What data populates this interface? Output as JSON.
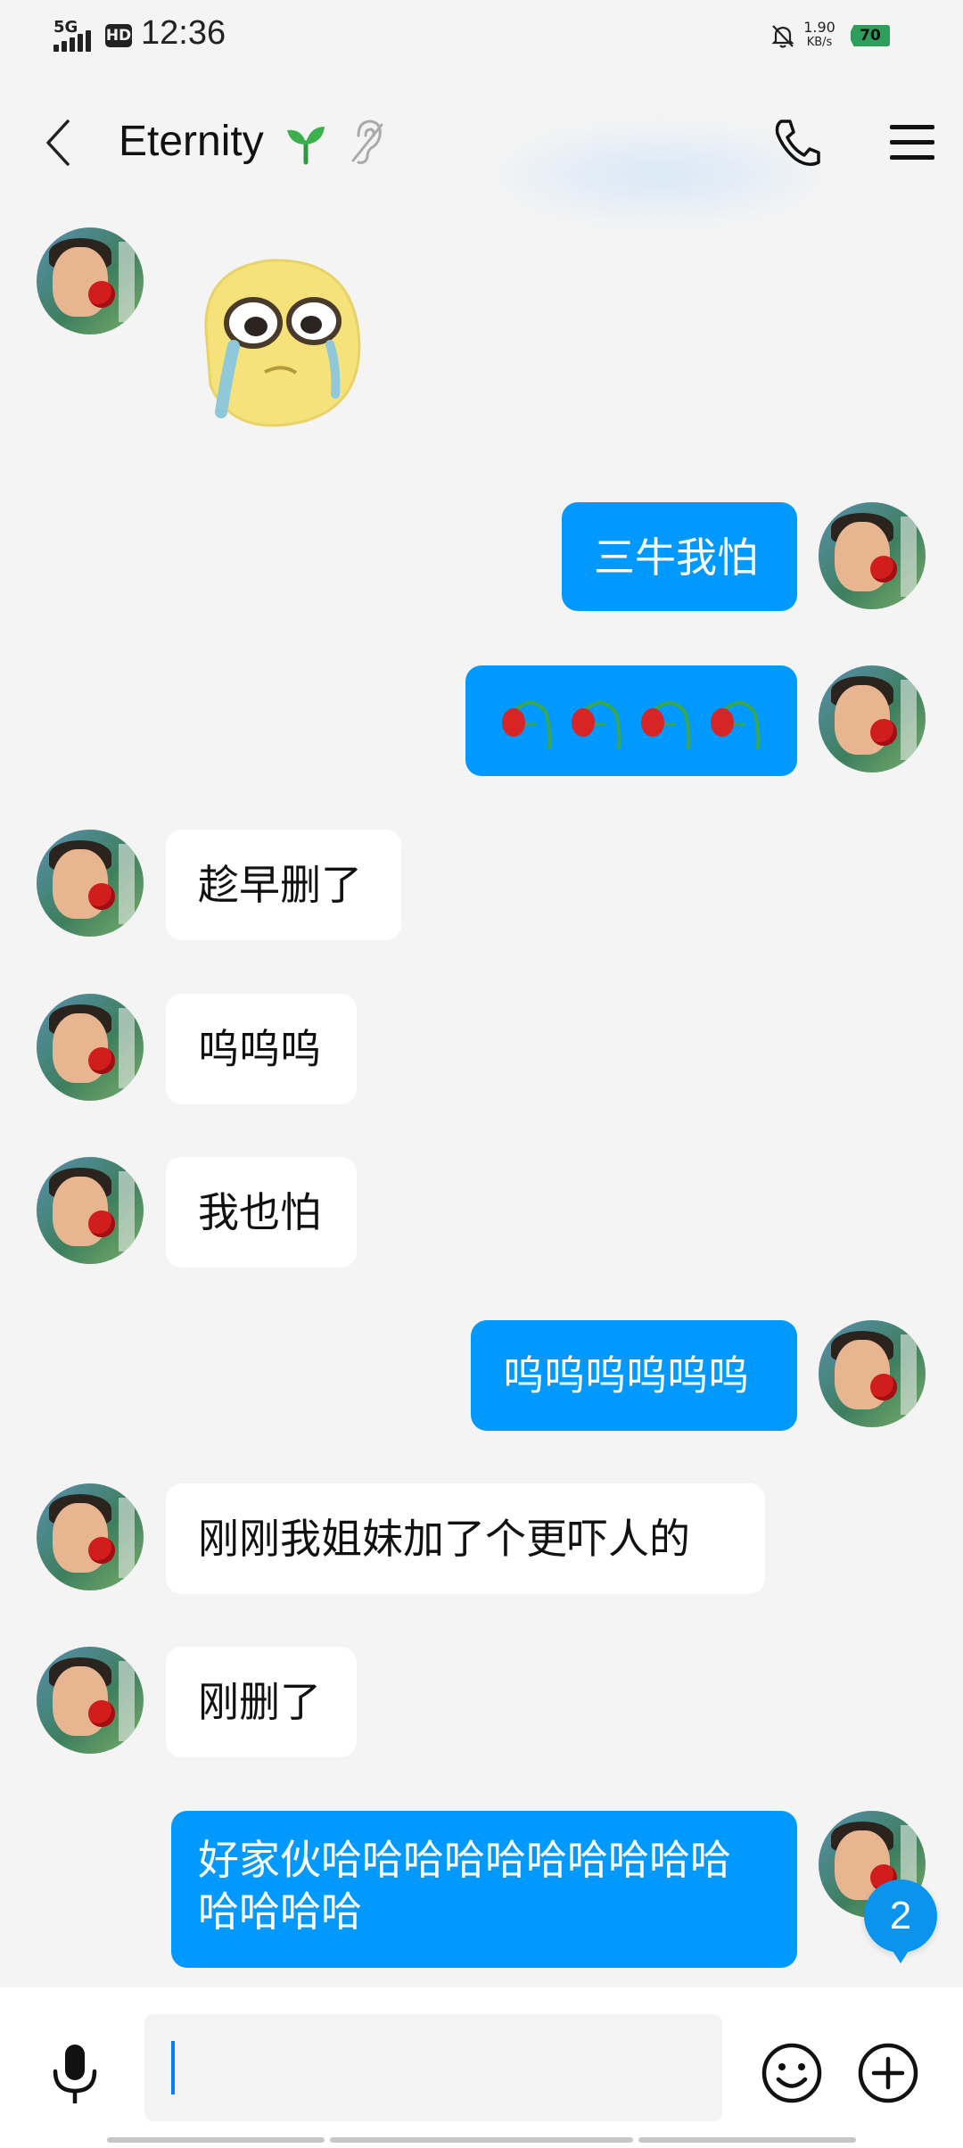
{
  "status_bar": {
    "network": "5G",
    "hd_label": "HD",
    "time": "12:36",
    "speed_value": "1.90",
    "speed_unit": "KB/s",
    "battery": "70"
  },
  "header": {
    "contact_name": "Eternity",
    "icons": [
      "back-icon",
      "sprout-icon",
      "ear-icon",
      "phone-icon",
      "menu-icon"
    ]
  },
  "messages": [
    {
      "side": "in",
      "type": "sticker",
      "sticker": "crying-face-sticker"
    },
    {
      "side": "out",
      "type": "text",
      "text": "三牛我怕"
    },
    {
      "side": "out",
      "type": "emoji",
      "emoji": "wilted-rose-icon",
      "count": 4
    },
    {
      "side": "in",
      "type": "text",
      "text": "趁早删了"
    },
    {
      "side": "in",
      "type": "text",
      "text": "呜呜呜"
    },
    {
      "side": "in",
      "type": "text",
      "text": "我也怕"
    },
    {
      "side": "out",
      "type": "text",
      "text": "呜呜呜呜呜呜"
    },
    {
      "side": "in",
      "type": "text",
      "text": "刚刚我姐妹加了个更吓人的"
    },
    {
      "side": "in",
      "type": "text",
      "text": "刚删了"
    },
    {
      "side": "out",
      "type": "text",
      "text": "好家伙哈哈哈哈哈哈哈哈哈哈哈哈哈哈"
    }
  ],
  "unread_badge": "2",
  "input_bar": {
    "placeholder": "",
    "icons": [
      "mic-icon",
      "emoji-icon",
      "plus-icon"
    ]
  },
  "colors": {
    "background": "#f4f4f4",
    "outgoing_bubble": "#0099ff",
    "incoming_bubble": "#ffffff",
    "badge": "#0a94ee"
  }
}
